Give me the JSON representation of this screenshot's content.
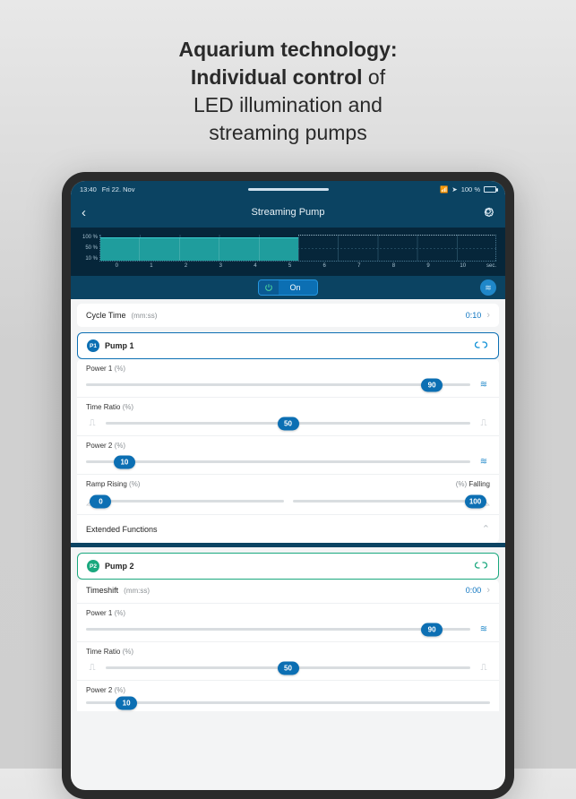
{
  "headline": {
    "line1_bold": "Aquarium technology:",
    "line2_bold": "Individual control",
    "line2_reg": " of",
    "line3": "LED illumination and",
    "line4": "streaming pumps"
  },
  "statusbar": {
    "time": "13:40",
    "date": "Fri 22. Nov",
    "battery_pct": "100 %"
  },
  "nav": {
    "title": "Streaming Pump"
  },
  "chart_data": {
    "type": "line",
    "title": "",
    "xlabel": "sec.",
    "ylabel": "%",
    "ylim": [
      10,
      100
    ],
    "x": [
      0,
      1,
      2,
      3,
      4,
      5,
      6,
      7,
      8,
      9,
      10
    ],
    "y_ticks": [
      "100 %",
      "50 %",
      "10 %"
    ],
    "x_ticks": [
      "0",
      "1",
      "2",
      "3",
      "4",
      "5",
      "6",
      "7",
      "8",
      "9",
      "10"
    ],
    "x_unit": "sec.",
    "series": [
      {
        "name": "Pump 1",
        "active_range": [
          0,
          5
        ],
        "power_high": 90,
        "power_low": 10
      }
    ]
  },
  "toggle": {
    "label": "On"
  },
  "cycle": {
    "label": "Cycle Time",
    "unit": "(mm:ss)",
    "value": "0:10"
  },
  "pump1": {
    "badge": "P1",
    "name": "Pump 1",
    "power1": {
      "label": "Power 1",
      "unit": "(%)",
      "value": 90
    },
    "time_ratio": {
      "label": "Time Ratio",
      "unit": "(%)",
      "value": 50
    },
    "power2": {
      "label": "Power 2",
      "unit": "(%)",
      "value": 10
    },
    "ramp_rising": {
      "label": "Ramp Rising",
      "unit": "(%)",
      "value": 0
    },
    "ramp_falling": {
      "label": "Falling",
      "unit": "(%)",
      "value": 100
    },
    "extended": "Extended Functions"
  },
  "pump2": {
    "badge": "P2",
    "name": "Pump 2",
    "timeshift": {
      "label": "Timeshift",
      "unit": "(mm:ss)",
      "value": "0:00"
    },
    "power1": {
      "label": "Power 1",
      "unit": "(%)",
      "value": 90
    },
    "time_ratio": {
      "label": "Time Ratio",
      "unit": "(%)",
      "value": 50
    },
    "power2": {
      "label": "Power 2",
      "unit": "(%)",
      "value": 10
    }
  }
}
